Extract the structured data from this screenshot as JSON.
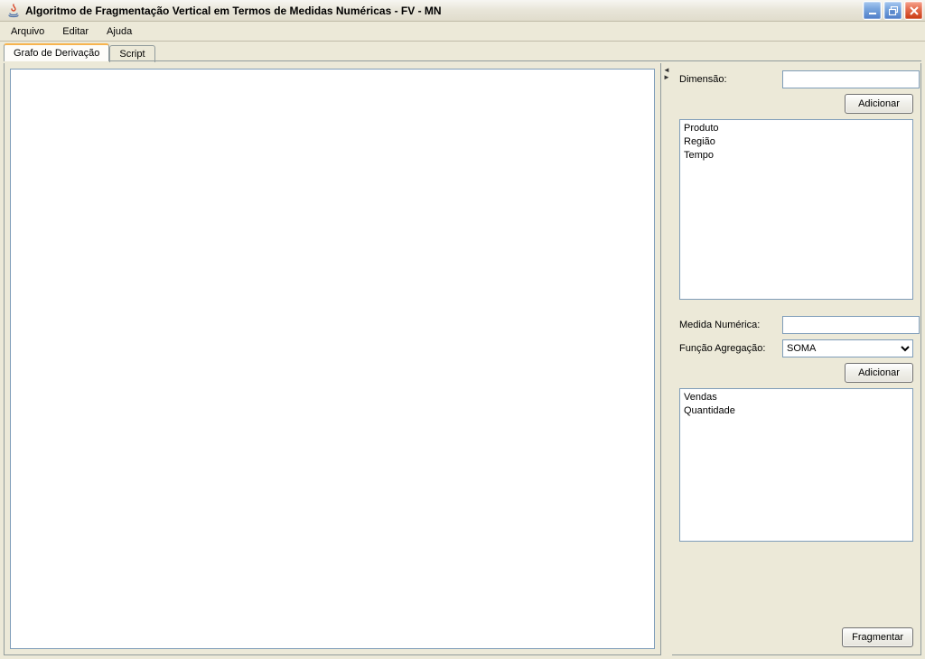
{
  "window": {
    "title": "Algoritmo de Fragmentação Vertical em Termos de Medidas Numéricas - FV - MN"
  },
  "menubar": {
    "items": [
      "Arquivo",
      "Editar",
      "Ajuda"
    ]
  },
  "tabs": {
    "items": [
      {
        "label": "Grafo de Derivação",
        "active": true
      },
      {
        "label": "Script",
        "active": false
      }
    ]
  },
  "side": {
    "dimension_label": "Dimensão:",
    "dimension_value": "",
    "add_button_1": "Adicionar",
    "dimension_list": [
      "Produto",
      "Região",
      "Tempo"
    ],
    "measure_label": "Medida Numérica:",
    "measure_value": "",
    "agg_label": "Função Agregação:",
    "agg_selected": "SOMA",
    "add_button_2": "Adicionar",
    "measure_list": [
      "Vendas",
      "Quantidade"
    ],
    "fragment_button": "Fragmentar"
  }
}
